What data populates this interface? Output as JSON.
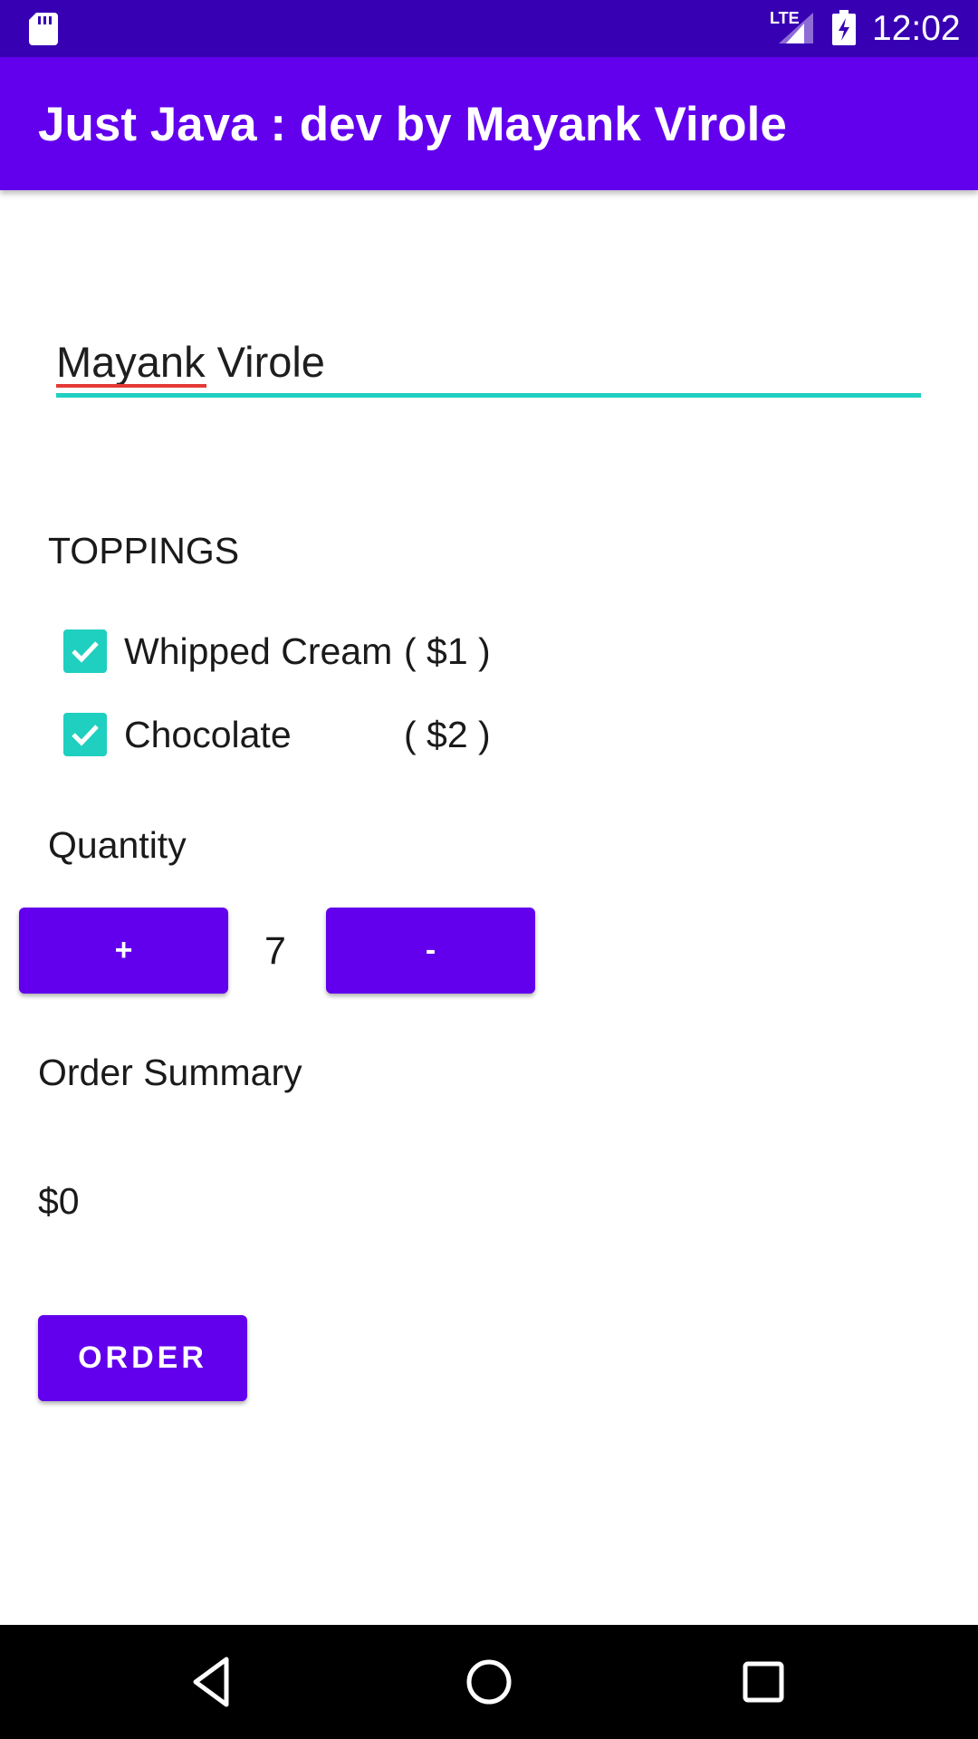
{
  "status_bar": {
    "time": "12:02",
    "network": "LTE",
    "icons": [
      "sd-card-icon",
      "signal-icon",
      "battery-charging-icon"
    ]
  },
  "app_bar": {
    "title": "Just Java : dev by Mayank Virole"
  },
  "name_field": {
    "value": "Mayank Virole"
  },
  "toppings": {
    "heading": "TOPPINGS",
    "items": [
      {
        "label": "Whipped Cream",
        "price": "( $1 )",
        "checked": true
      },
      {
        "label": "Chocolate",
        "price": "( $2 )",
        "checked": true
      }
    ]
  },
  "quantity": {
    "heading": "Quantity",
    "increment_label": "+",
    "value": "7",
    "decrement_label": "-"
  },
  "summary": {
    "heading": "Order Summary",
    "price": "$0"
  },
  "order_button": {
    "label": "ORDER"
  },
  "nav_bar": {
    "icons": [
      "back-icon",
      "home-icon",
      "recents-icon"
    ]
  },
  "colors": {
    "status_bar": "#3700b3",
    "primary": "#6200ee",
    "accent": "#1fcfc0",
    "spell_error": "#e53935"
  }
}
